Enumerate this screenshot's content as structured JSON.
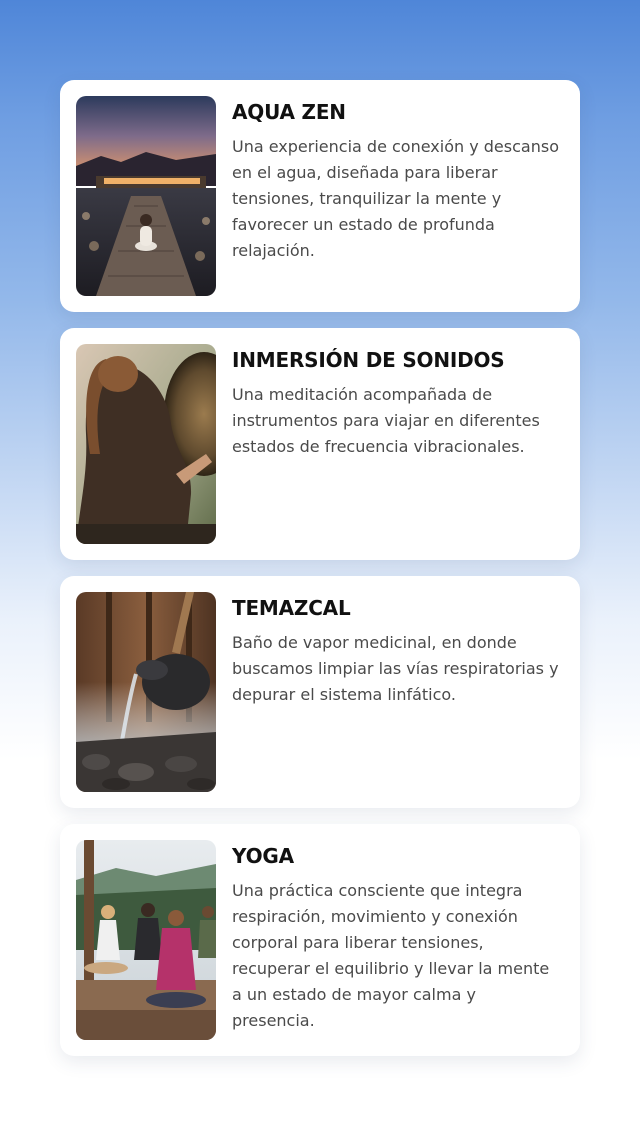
{
  "activities": [
    {
      "title": "AQUA ZEN",
      "description": "Una experiencia de conexión y descanso en el agua, diseñada para liberar tensiones, tranquilizar la mente y favorecer un estado de profunda relajación.",
      "image_icon": "pool-meditation-image"
    },
    {
      "title": "INMERSIÓN DE SONIDOS",
      "description": "Una meditación acompañada de instrumentos para viajar en diferentes estados de frecuencia vibracionales.",
      "image_icon": "gong-image"
    },
    {
      "title": "TEMAZCAL",
      "description": "Baño de vapor medicinal, en donde buscamos limpiar las vías respiratorias y depurar el sistema linfático.",
      "image_icon": "water-pouring-stones-image"
    },
    {
      "title": "YOGA",
      "description": "Una práctica consciente que integra respiración, movimiento y conexión corporal para liberar tensiones, recuperar el equilibrio y llevar la mente a un estado de mayor calma y presencia.",
      "image_icon": "yoga-class-image"
    }
  ],
  "colors": {
    "background_top": "#4f86d8",
    "background_bottom": "#ffffff",
    "card": "#ffffff",
    "title": "#111111",
    "description": "#4a4a4a"
  }
}
